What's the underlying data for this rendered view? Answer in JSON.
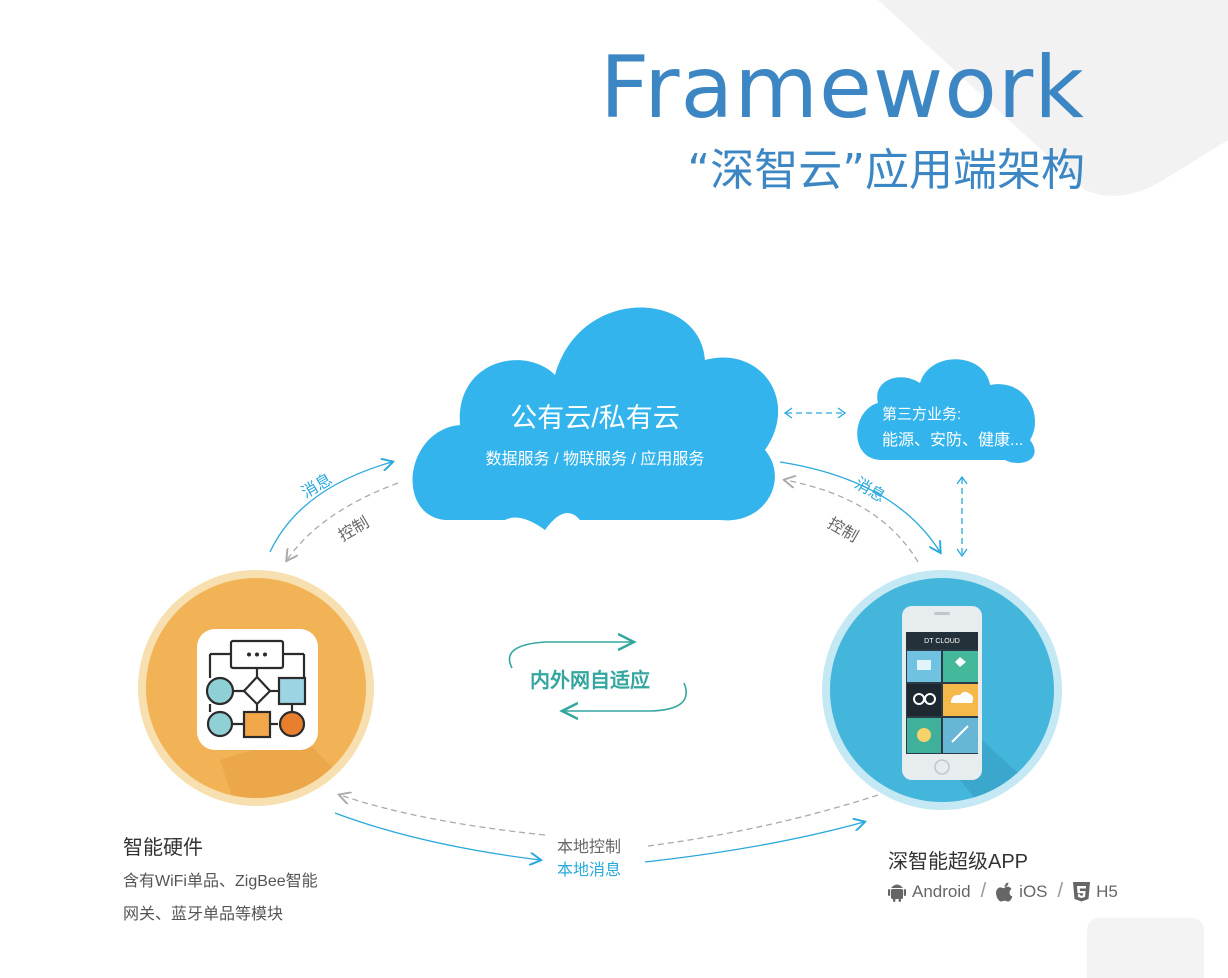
{
  "header": {
    "title": "Framework",
    "subtitle": "“深智云”应用端架构"
  },
  "cloud": {
    "title": "公有云/私有云",
    "services": "数据服务 / 物联服务 / 应用服务"
  },
  "third_party": {
    "line1": "第三方业务:",
    "line2": "能源、安防、健康..."
  },
  "links": {
    "left_message": "消息",
    "left_control": "控制",
    "right_message": "消息",
    "right_control": "控制",
    "inner_outer": "内外网自适应",
    "local_control": "本地控制",
    "local_message": "本地消息"
  },
  "hardware": {
    "title": "智能硬件",
    "desc_line1": "含有WiFi单品、ZigBee智能",
    "desc_line2": "网关、蓝牙单品等模块"
  },
  "app": {
    "title": "深智能超级APP",
    "screen_header": "DT CLOUD",
    "platforms": [
      {
        "name": "Android",
        "icon": "android-icon"
      },
      {
        "name": "iOS",
        "icon": "apple-icon"
      },
      {
        "name": "H5",
        "icon": "html5-icon"
      }
    ]
  },
  "colors": {
    "title_blue": "#3d86c4",
    "cloud_blue": "#34b4ec",
    "teal": "#34a6a0",
    "hardware_orange": "#f2b256",
    "app_blue": "#44b6dc"
  }
}
